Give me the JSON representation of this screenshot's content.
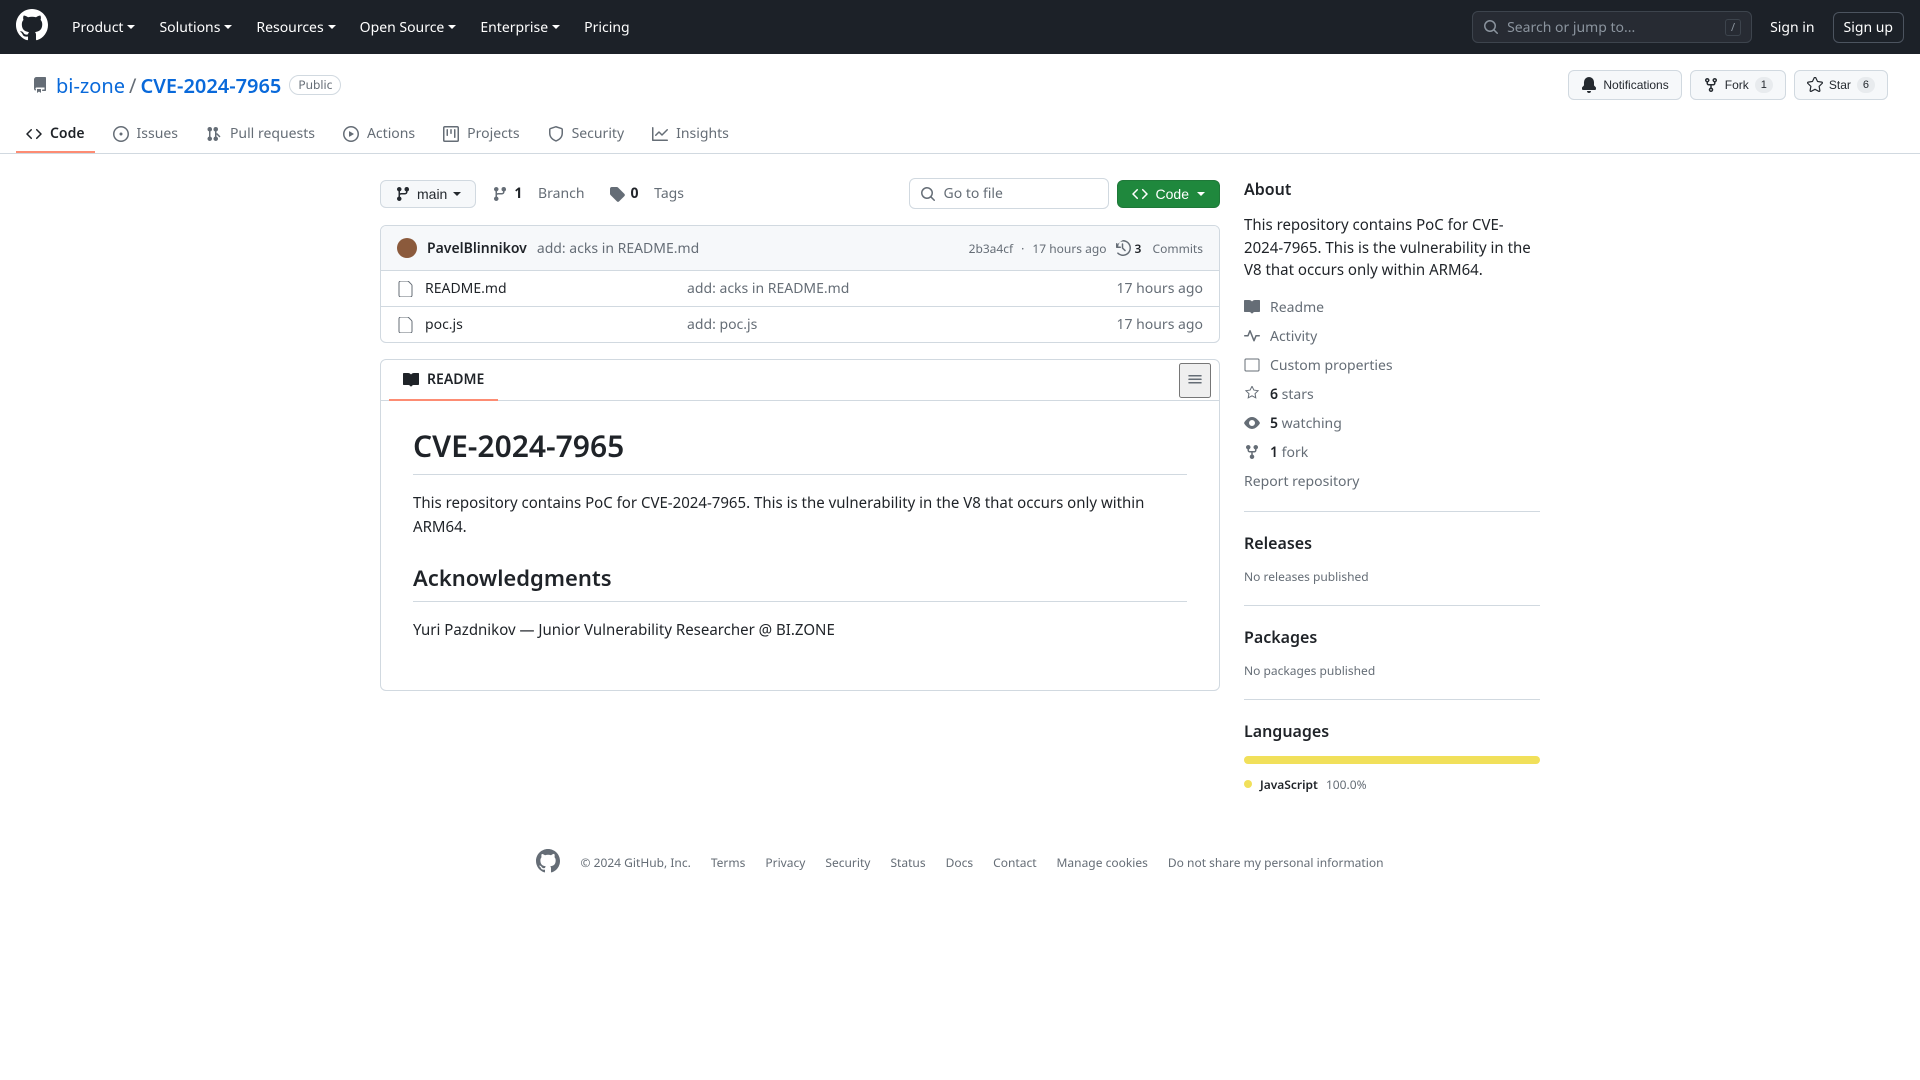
{
  "header": {
    "nav": [
      "Product",
      "Solutions",
      "Resources",
      "Open Source",
      "Enterprise",
      "Pricing"
    ],
    "search_placeholder": "Search or jump to...",
    "slash": "/",
    "signin": "Sign in",
    "signup": "Sign up"
  },
  "repo": {
    "owner": "bi-zone",
    "name": "CVE-2024-7965",
    "visibility": "Public",
    "actions": {
      "notifications": "Notifications",
      "fork": "Fork",
      "fork_count": "1",
      "star": "Star",
      "star_count": "6"
    }
  },
  "tabs": [
    "Code",
    "Issues",
    "Pull requests",
    "Actions",
    "Projects",
    "Security",
    "Insights"
  ],
  "toolbar": {
    "branch": "main",
    "branches_count": "1",
    "branches_label": "Branch",
    "tags_count": "0",
    "tags_label": "Tags",
    "file_search_placeholder": "Go to file",
    "code": "Code"
  },
  "commit": {
    "author": "PavelBlinnikov",
    "message": "add: acks in README.md",
    "sha": "2b3a4cf",
    "sep": "·",
    "time": "17 hours ago",
    "commits_count": "3",
    "commits_label": "Commits"
  },
  "files": [
    {
      "name": "README.md",
      "msg": "add: acks in README.md",
      "time": "17 hours ago"
    },
    {
      "name": "poc.js",
      "msg": "add: poc.js",
      "time": "17 hours ago"
    }
  ],
  "readme": {
    "tab": "README",
    "h1": "CVE-2024-7965",
    "p1": "This repository contains PoC for CVE-2024-7965. This is the vulnerability in the V8 that occurs only within ARM64.",
    "h2": "Acknowledgments",
    "p2": "Yuri Pazdnikov — Junior Vulnerability Researcher @ BI.ZONE"
  },
  "about": {
    "title": "About",
    "desc": "This repository contains PoC for CVE-2024-7965. This is the vulnerability in the V8 that occurs only within ARM64.",
    "readme": "Readme",
    "activity": "Activity",
    "custom_props": "Custom properties",
    "stars_n": "6",
    "stars": "stars",
    "watching_n": "5",
    "watching": "watching",
    "forks_n": "1",
    "forks": "fork",
    "report": "Report repository"
  },
  "releases": {
    "title": "Releases",
    "none": "No releases published"
  },
  "packages": {
    "title": "Packages",
    "none": "No packages published"
  },
  "languages": {
    "title": "Languages",
    "items": [
      {
        "name": "JavaScript",
        "pct": "100.0%",
        "color": "#f1e05a"
      }
    ]
  },
  "footer": {
    "copyright": "© 2024 GitHub, Inc.",
    "links": [
      "Terms",
      "Privacy",
      "Security",
      "Status",
      "Docs",
      "Contact",
      "Manage cookies",
      "Do not share my personal information"
    ]
  }
}
